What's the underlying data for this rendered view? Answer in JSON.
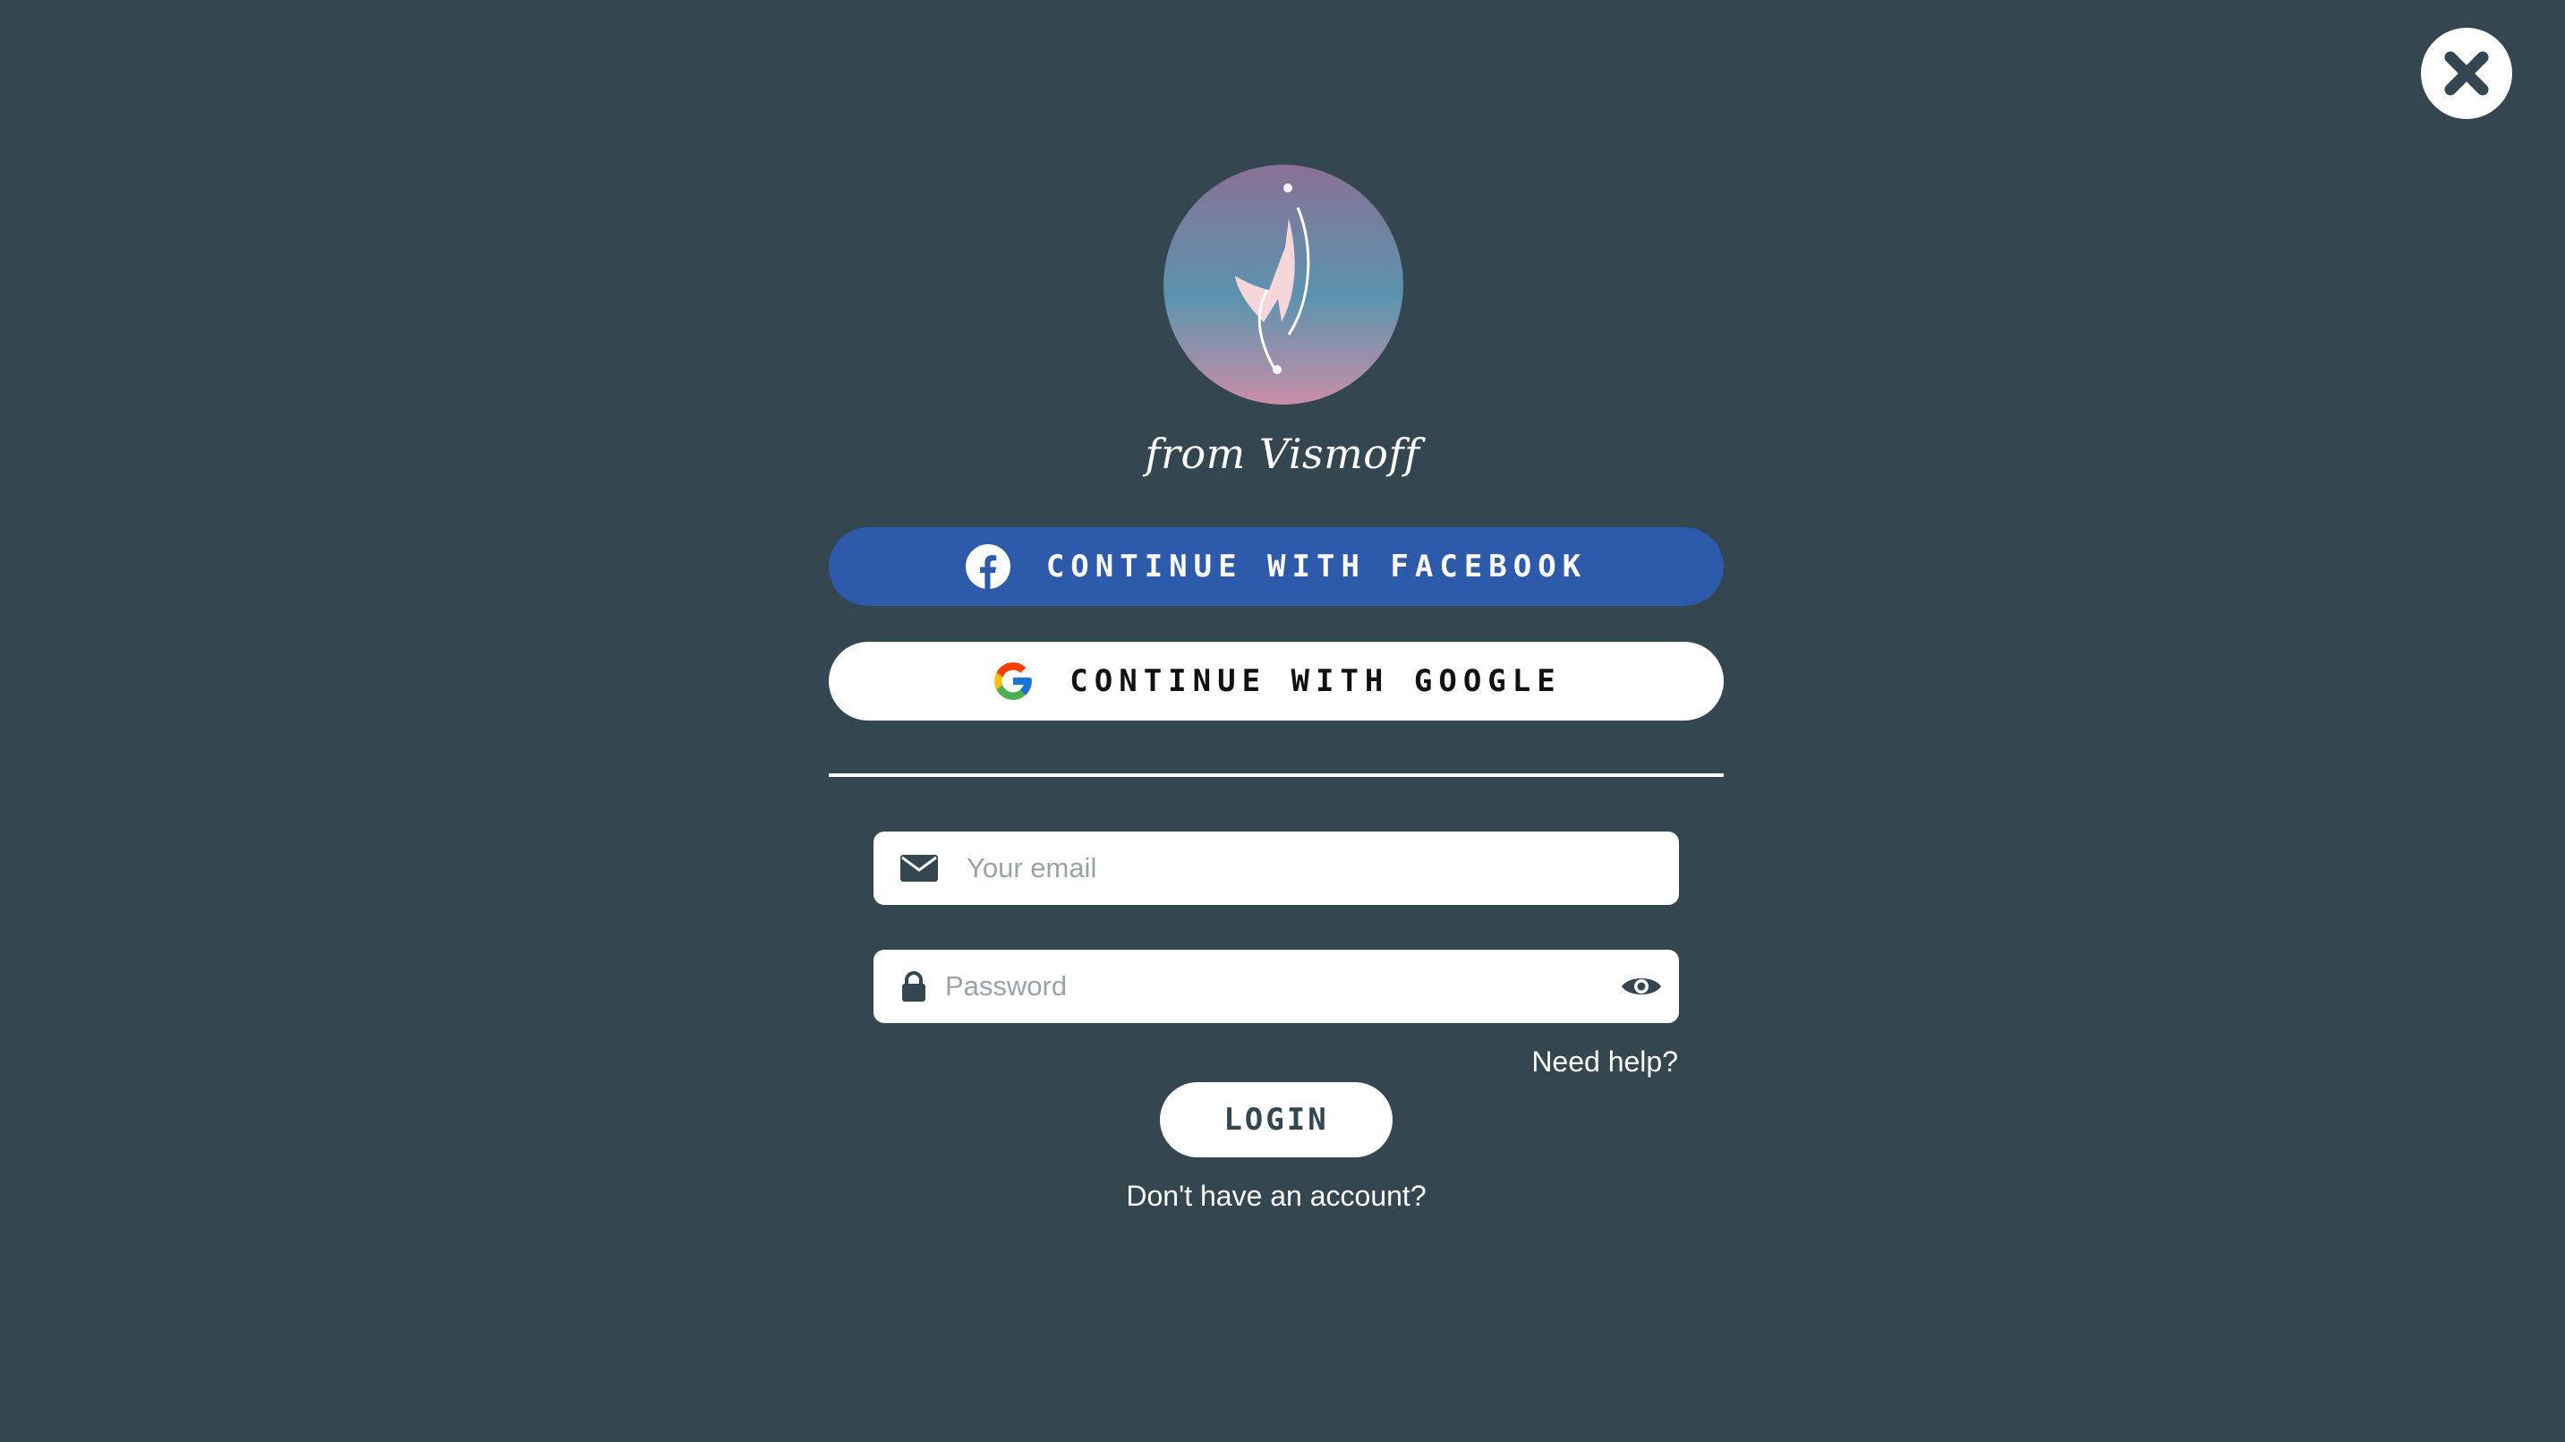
{
  "brand": {
    "tagline": "from Vismoff",
    "colors": {
      "background": "#34464f",
      "facebook": "#2d5aab",
      "white": "#ffffff"
    }
  },
  "header": {
    "close_icon": "close-icon"
  },
  "social": {
    "facebook_label": "CONTINUE WITH FACEBOOK",
    "facebook_icon": "facebook-icon",
    "google_label": "CONTINUE WITH GOOGLE",
    "google_icon": "google-icon"
  },
  "form": {
    "email_placeholder": "Your email",
    "email_icon": "envelope-icon",
    "password_placeholder": "Password",
    "password_icon": "lock-icon",
    "show_password_icon": "eye-icon",
    "need_help": "Need help?",
    "login_label": "LOGIN",
    "signup_prompt": "Don't have an account?"
  }
}
